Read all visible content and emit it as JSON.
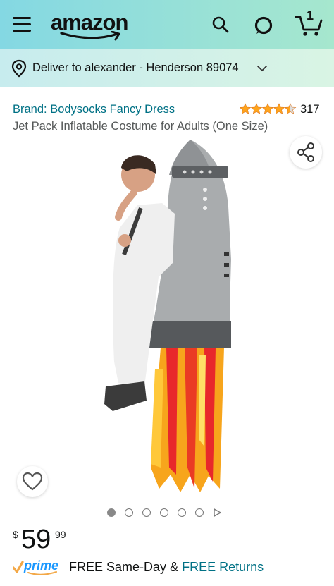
{
  "header": {
    "logo_text": "amazon",
    "cart_count": "1",
    "icons": [
      "menu-icon",
      "search-icon",
      "alexa-icon",
      "cart-icon"
    ]
  },
  "delivery": {
    "text": "Deliver to alexander - Henderson 89074"
  },
  "product": {
    "brand_text": "Brand: Bodysocks Fancy Dress",
    "rating": 4.5,
    "rating_count": "317",
    "title": "Jet Pack Inflatable Costume for Adults (One Size)",
    "image_count": 6,
    "active_image": 1
  },
  "price": {
    "symbol": "$",
    "whole": "59",
    "fraction": "99"
  },
  "shipping": {
    "prime_label": "prime",
    "free_same_day": "FREE Same-Day",
    "amp": "&",
    "free_returns": "FREE Returns"
  },
  "colors": {
    "header_start": "#84d8e3",
    "header_end": "#a6e7ce",
    "link": "#007185",
    "star": "#ffa41c",
    "prime_blue": "#1a98ff",
    "prime_check": "#f3a847"
  }
}
